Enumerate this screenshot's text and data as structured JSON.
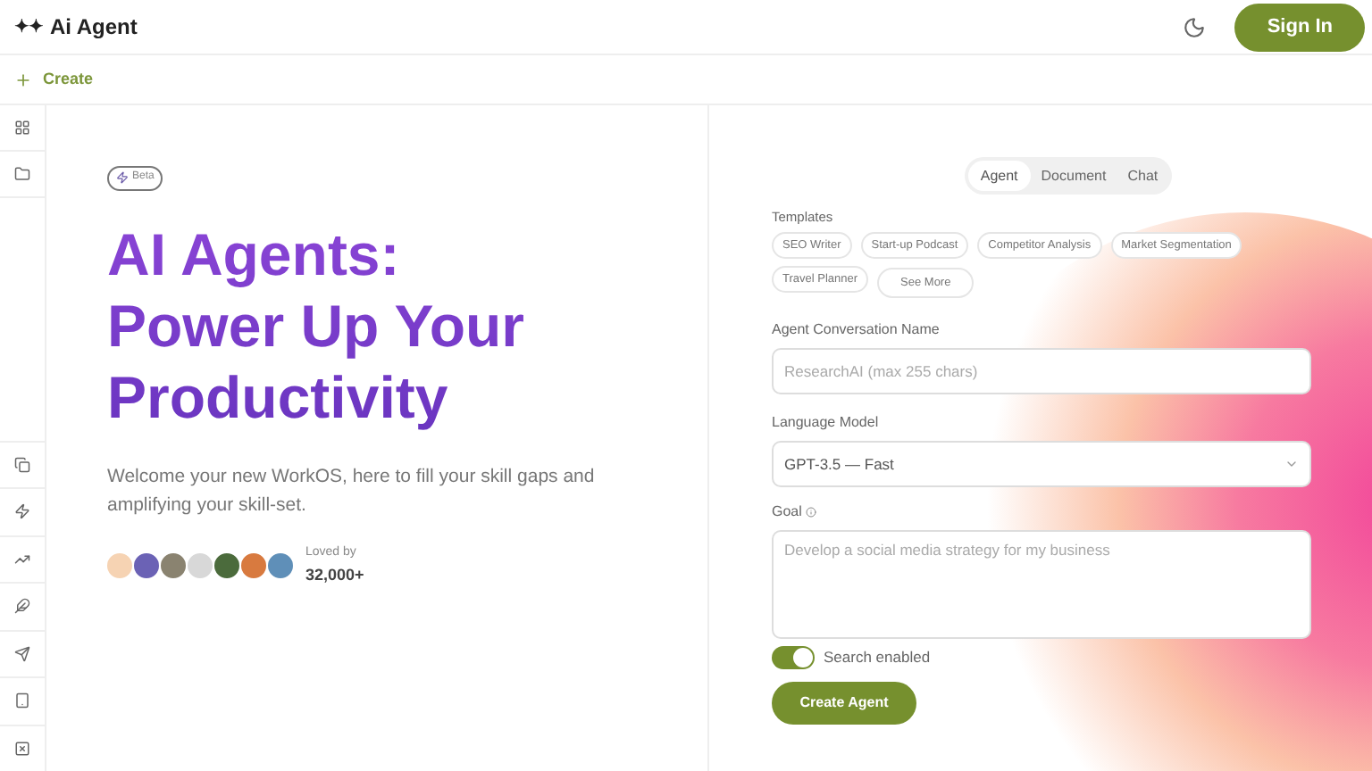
{
  "header": {
    "logo": "✦✦",
    "title": "Ai Agent",
    "sign_in": "Sign In"
  },
  "create": {
    "label": "Create"
  },
  "hero": {
    "badge": "Beta",
    "title_lines": [
      "AI Agents:",
      "Power Up Your",
      "Productivity"
    ],
    "description": "Welcome your new WorkOS, here to fill your skill gaps and amplifying your skill-set.",
    "loved_label": "Loved by",
    "loved_count": "32,000+"
  },
  "tabs": [
    {
      "label": "Agent",
      "selected": true
    },
    {
      "label": "Document",
      "selected": false
    },
    {
      "label": "Chat",
      "selected": false
    }
  ],
  "templates": {
    "label": "Templates",
    "items": [
      "SEO Writer",
      "Start-up Podcast",
      "Competitor Analysis",
      "Market Segmentation",
      "Travel Planner",
      "See More"
    ]
  },
  "name_field": {
    "label": "Agent Conversation Name",
    "placeholder": "ResearchAI (max 255 chars)"
  },
  "model_field": {
    "label": "Language Model",
    "value": "GPT-3.5 — Fast"
  },
  "goal_field": {
    "label": "Goal",
    "placeholder": "Develop a social media strategy for my business"
  },
  "search_toggle": {
    "label": "Search enabled",
    "on": true
  },
  "submit": "Create Agent"
}
